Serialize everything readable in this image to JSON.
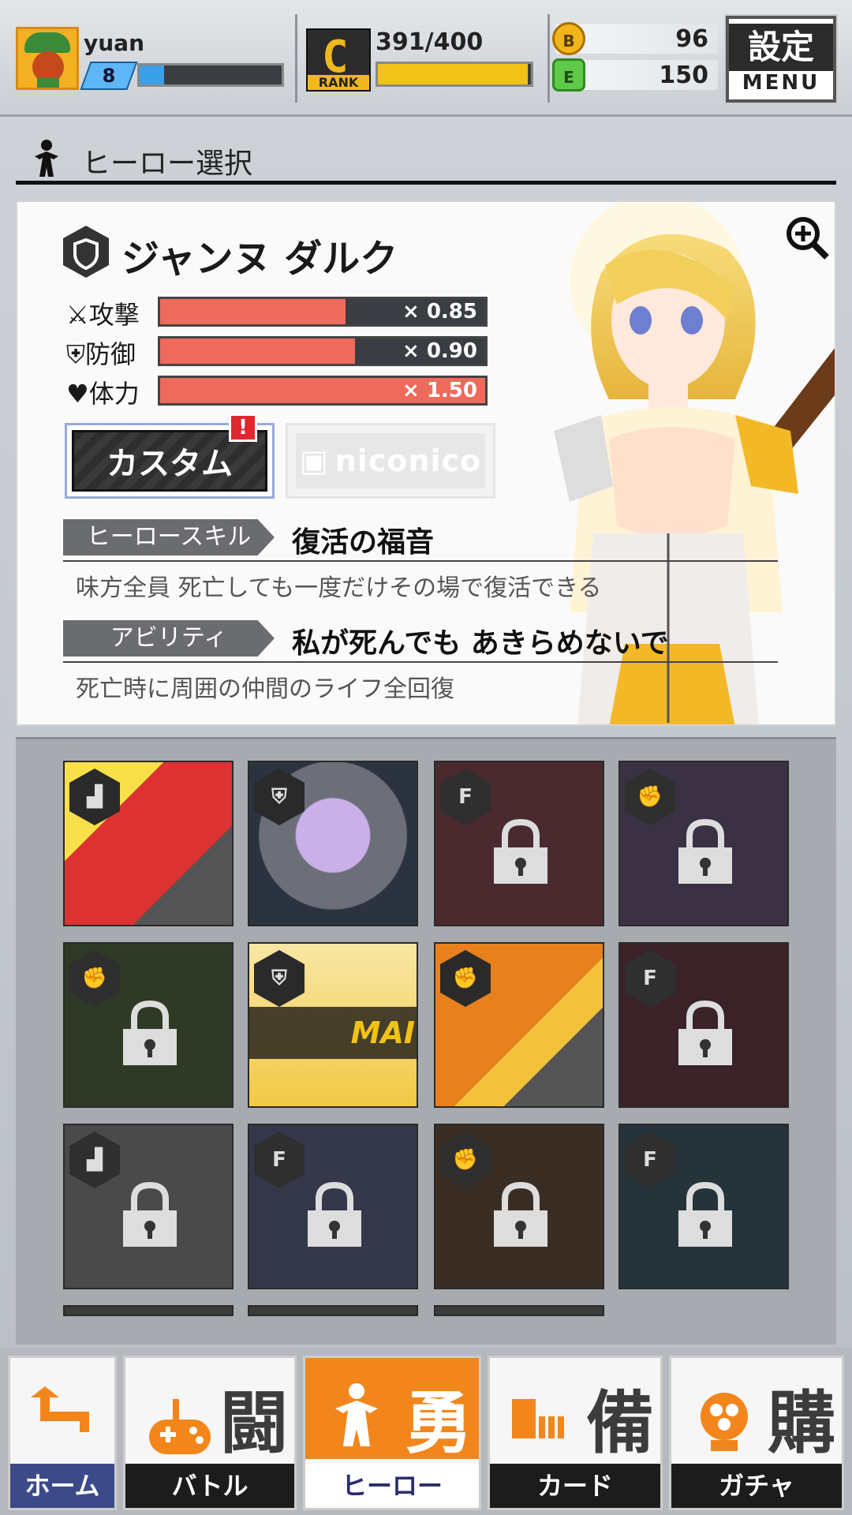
{
  "header": {
    "username": "yuan",
    "level": "8",
    "xp_fraction": 0.17,
    "rank_letter": "C",
    "rank_label": "RANK",
    "stamina": "391/400",
    "stamina_fraction": 0.9775,
    "currency_b_icon": "B",
    "currency_b": "96",
    "currency_e_icon": "E",
    "currency_e": "150",
    "menu_jp": "設定",
    "menu_en": "MENU"
  },
  "section": {
    "title": "ヒーロー選択"
  },
  "hero": {
    "name": "ジャンヌ ダルク",
    "stats": [
      {
        "label": "攻撃",
        "mult": "× 0.85",
        "fill": 0.57
      },
      {
        "label": "防御",
        "mult": "× 0.90",
        "fill": 0.6
      },
      {
        "label": "体力",
        "mult": "× 1.50",
        "fill": 1.0
      }
    ],
    "custom_label": "カスタム",
    "alert": "!",
    "niconico_label": "niconico",
    "skill_tag": "ヒーロースキル",
    "skill_name": "復活の福音",
    "skill_desc": "味方全員 死亡しても一度だけその場で復活できる",
    "ability_tag": "アビリティ",
    "ability_name": "私が死んでも あきらめないで",
    "ability_desc": "死亡時に周囲の仲間のライフ全回復"
  },
  "grid": {
    "selected_tag": "MAI"
  },
  "nav": [
    {
      "label": "ホーム",
      "kanji": ""
    },
    {
      "label": "バトル",
      "kanji": "闘"
    },
    {
      "label": "ヒーロー",
      "kanji": "勇"
    },
    {
      "label": "カード",
      "kanji": "備"
    },
    {
      "label": "ガチャ",
      "kanji": "購"
    }
  ],
  "colors": {
    "accent": "#f2861c",
    "stat_fill": "#ee6a5c",
    "stamina": "#f2c217",
    "xp": "#3aa0e8"
  }
}
